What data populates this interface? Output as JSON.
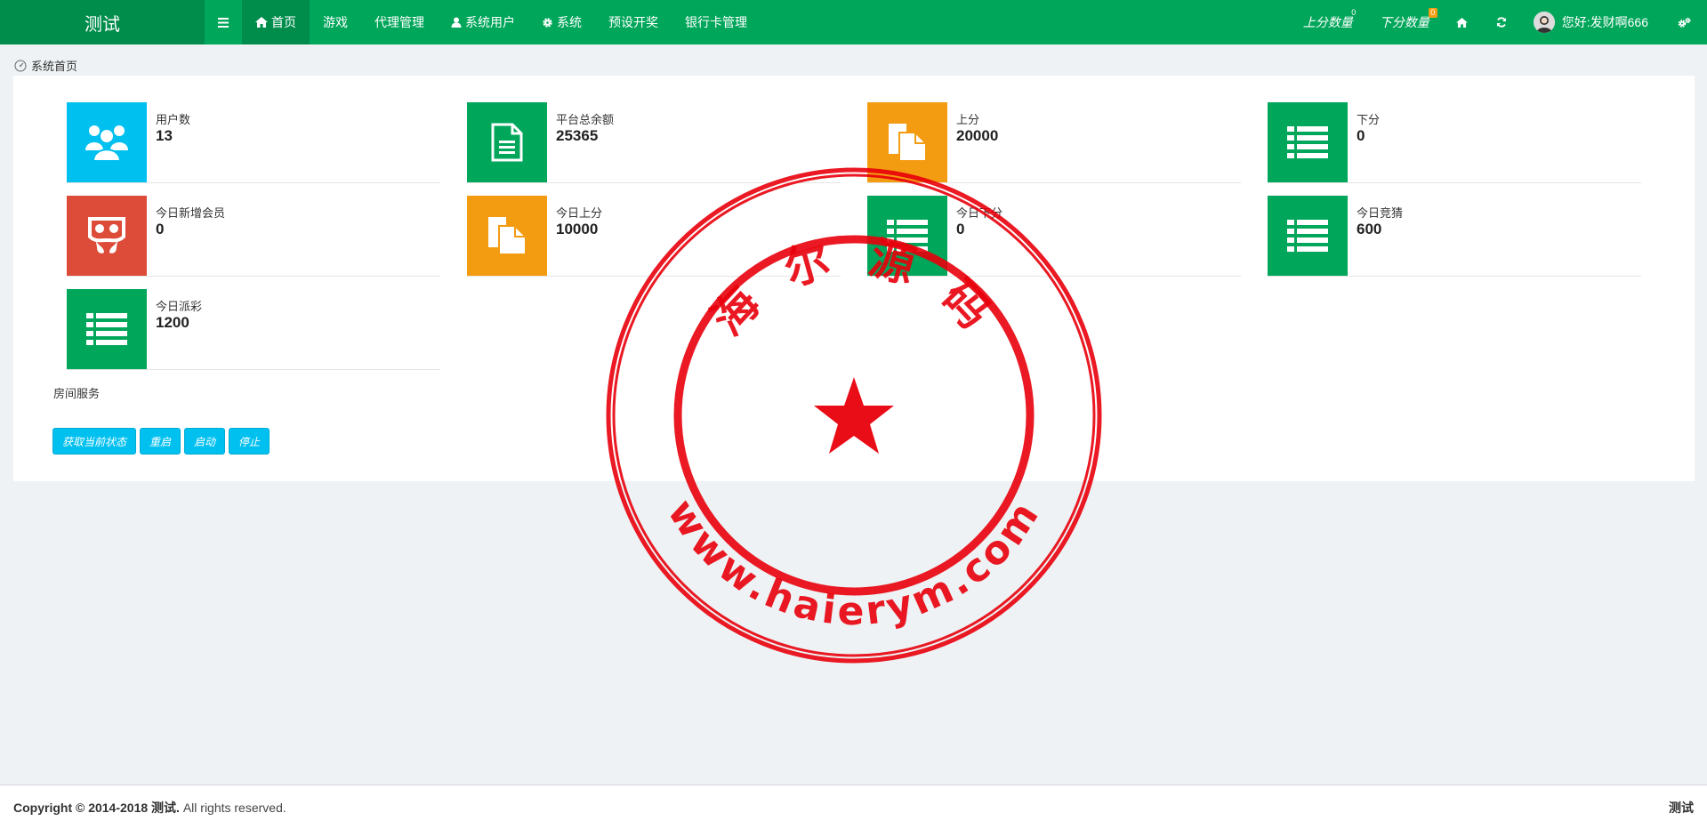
{
  "navbar": {
    "brand": "测试",
    "menu": [
      {
        "label": "首页",
        "icon": "home-icon",
        "active": true
      },
      {
        "label": "游戏",
        "icon": "",
        "active": false
      },
      {
        "label": "代理管理",
        "icon": "",
        "active": false
      },
      {
        "label": "系统用户",
        "icon": "user-icon",
        "active": false
      },
      {
        "label": "系统",
        "icon": "gear-icon",
        "active": false
      },
      {
        "label": "预设开奖",
        "icon": "",
        "active": false
      },
      {
        "label": "银行卡管理",
        "icon": "",
        "active": false
      }
    ],
    "up_count_label": "上分数量",
    "up_count_badge": "0",
    "down_count_label": "下分数量",
    "down_count_badge": "0",
    "greeting": "您好:发财啊666",
    "colors": {
      "primary": "#00a65a",
      "primary_dark": "#008d4c"
    }
  },
  "breadcrumb": "系统首页",
  "stats": [
    {
      "label": "用户数",
      "value": "13",
      "icon": "users-icon",
      "color": "#00c0ef"
    },
    {
      "label": "平台总余额",
      "value": "25365",
      "icon": "document-icon",
      "color": "#00a65a"
    },
    {
      "label": "上分",
      "value": "20000",
      "icon": "copy-files-icon",
      "color": "#f39c12"
    },
    {
      "label": "下分",
      "value": "0",
      "icon": "list-icon",
      "color": "#00a65a"
    },
    {
      "label": "今日新增会员",
      "value": "0",
      "icon": "slideshare-icon",
      "color": "#dd4b39"
    },
    {
      "label": "今日上分",
      "value": "10000",
      "icon": "copy-files-icon",
      "color": "#f39c12"
    },
    {
      "label": "今日下分",
      "value": "0",
      "icon": "list-icon",
      "color": "#00a65a"
    },
    {
      "label": "今日竞猜",
      "value": "600",
      "icon": "list-icon",
      "color": "#00a65a"
    },
    {
      "label": "今日派彩",
      "value": "1200",
      "icon": "list-icon",
      "color": "#00a65a"
    }
  ],
  "room_service": {
    "title": "房间服务",
    "buttons": [
      "获取当前状态",
      "重启",
      "启动",
      "停止"
    ]
  },
  "footer": {
    "copyright_prefix": "Copyright © 2014-2018 ",
    "copyright_brand": "测试.",
    "copyright_suffix": " All rights reserved.",
    "right": "测试"
  },
  "watermark": {
    "top_text": "海 尔 源 码",
    "bottom_text": "www.haierym.com",
    "color": "#e8000b"
  }
}
